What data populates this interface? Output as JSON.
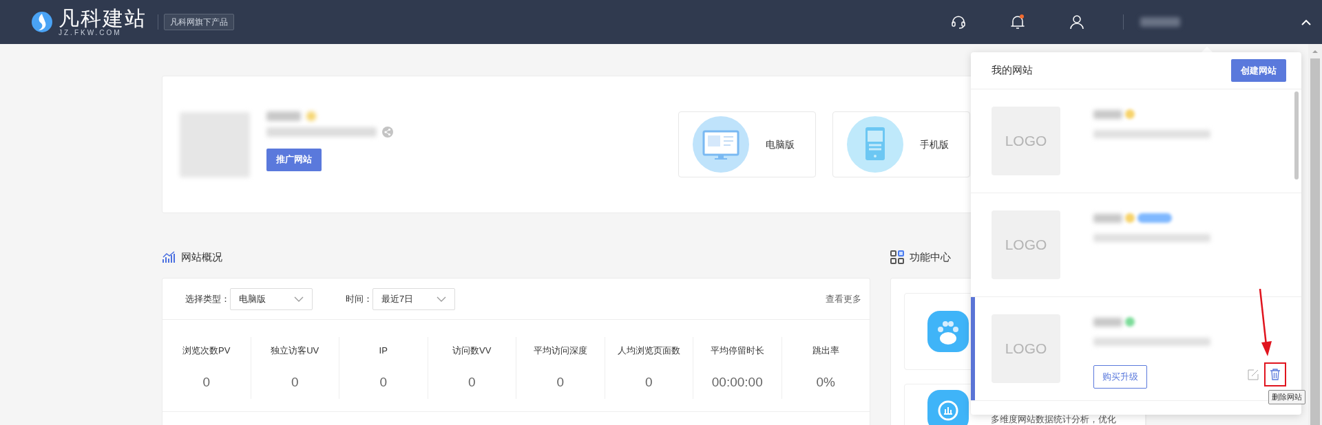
{
  "header": {
    "logo_title": "凡科建站",
    "logo_subtitle": "JZ.FKW.COM",
    "product_badge": "凡科网旗下产品",
    "notification_unread": true
  },
  "site_panel": {
    "promote_button": "推广网站",
    "versions": [
      {
        "kind": "desktop",
        "label": "电脑版"
      },
      {
        "kind": "mobile",
        "label": "手机版"
      }
    ]
  },
  "overview": {
    "title": "网站概况",
    "filters": [
      {
        "label": "选择类型：",
        "value": "电脑版"
      },
      {
        "label": "时间：",
        "value": "最近7日"
      }
    ],
    "more_link": "查看更多",
    "stats": [
      {
        "label": "浏览次数PV",
        "value": "0"
      },
      {
        "label": "独立访客UV",
        "value": "0"
      },
      {
        "label": "IP",
        "value": "0"
      },
      {
        "label": "访问数VV",
        "value": "0"
      },
      {
        "label": "平均访问深度",
        "value": "0"
      },
      {
        "label": "人均浏览页面数",
        "value": "0"
      },
      {
        "label": "平均停留时长",
        "value": "00:00:00"
      },
      {
        "label": "跳出率",
        "value": "0%"
      }
    ]
  },
  "function_center": {
    "title": "功能中心",
    "features": [
      {
        "kind": "paw"
      },
      {
        "kind": "analytics",
        "description": "多维度网站数据统计分析，优化"
      }
    ]
  },
  "my_sites": {
    "title": "我的网站",
    "create_button": "创建网站",
    "sites": [
      {
        "logo": "LOGO",
        "selected": false,
        "badges": [
          {
            "color": "#f7d36b"
          }
        ]
      },
      {
        "logo": "LOGO",
        "selected": false,
        "badges": [
          {
            "color": "#f7d36b"
          },
          {
            "color": "#7fb8ff"
          }
        ]
      },
      {
        "logo": "LOGO",
        "selected": true,
        "badges": [
          {
            "color": "#7ddc9a"
          }
        ],
        "upgrade_button": "购买升级"
      }
    ],
    "tooltip": "删除网站"
  }
}
